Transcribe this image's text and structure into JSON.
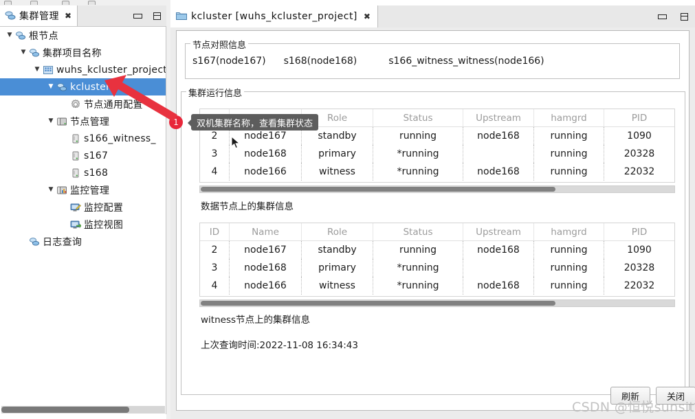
{
  "left_view": {
    "tab": {
      "title": "集群管理",
      "close": "✖",
      "icon": "cluster-icon"
    },
    "window_controls": {
      "minimize": "minimize-icon",
      "maximize": "maximize-icon"
    },
    "tree": [
      {
        "label": "根节点",
        "depth": 0,
        "twisty": "▼",
        "icon": "cluster-icon",
        "selected": false
      },
      {
        "label": "集群项目名称",
        "depth": 1,
        "twisty": "▼",
        "icon": "cluster-icon",
        "selected": false
      },
      {
        "label": "wuhs_kcluster_project",
        "depth": 2,
        "twisty": "▼",
        "icon": "project-icon",
        "selected": false
      },
      {
        "label": "kcluster",
        "depth": 3,
        "twisty": "▼",
        "icon": "cluster-icon",
        "selected": true
      },
      {
        "label": "节点通用配置",
        "depth": 4,
        "twisty": "",
        "icon": "gear-icon",
        "selected": false
      },
      {
        "label": "节点管理",
        "depth": 3,
        "twisty": "▼",
        "icon": "nodes-icon",
        "selected": false
      },
      {
        "label": "s166_witness_",
        "depth": 4,
        "twisty": "",
        "icon": "server-icon",
        "selected": false
      },
      {
        "label": "s167",
        "depth": 4,
        "twisty": "",
        "icon": "server-icon",
        "selected": false
      },
      {
        "label": "s168",
        "depth": 4,
        "twisty": "",
        "icon": "server-icon",
        "selected": false
      },
      {
        "label": "监控管理",
        "depth": 3,
        "twisty": "▼",
        "icon": "monitor-mgmt-icon",
        "selected": false
      },
      {
        "label": "监控配置",
        "depth": 4,
        "twisty": "",
        "icon": "monitor-config-icon",
        "selected": false
      },
      {
        "label": "监控视图",
        "depth": 4,
        "twisty": "",
        "icon": "monitor-view-icon",
        "selected": false
      },
      {
        "label": "日志查询",
        "depth": 1,
        "twisty": "",
        "icon": "log-icon",
        "selected": false
      }
    ]
  },
  "right_view": {
    "tab": {
      "title": "kcluster [wuhs_kcluster_project]",
      "close": "✖",
      "icon": "folder-icon"
    },
    "window_controls": {
      "minimize": "minimize-icon",
      "maximize": "maximize-icon"
    },
    "compare_group": {
      "legend": "节点对照信息",
      "entries": [
        "s167(node167)",
        "s168(node168)",
        "s166_witness_witness(node166)"
      ]
    },
    "run_group": {
      "legend": "集群运行信息",
      "table1_caption": "数据节点上的集群信息",
      "table2_caption": "witness节点上的集群信息",
      "last_query": "上次查询时间:2022-11-08  16:34:43"
    },
    "table": {
      "columns": [
        "ID",
        "Name",
        "Role",
        "Status",
        "Upstream",
        "hamgrd",
        "PID",
        ""
      ],
      "rows": [
        [
          "2",
          "node167",
          "standby",
          "running",
          "node168",
          "running",
          "1090",
          ""
        ],
        [
          "3",
          "node168",
          "primary",
          "*running",
          "",
          "running",
          "20328",
          ""
        ],
        [
          "4",
          "node166",
          "witness",
          "*running",
          "node168",
          "running",
          "22032",
          ""
        ]
      ]
    },
    "buttons": {
      "refresh": "刷新",
      "close": "关闭"
    }
  },
  "annotations": {
    "badge_1": "1",
    "tooltip": "双机集群名称，查看集群状态"
  },
  "watermark": "CSDN @恒悦sunsite",
  "colors": {
    "selection": "#4a8ed6",
    "badge": "#e8273a",
    "tooltip_bg": "#5d5d5d",
    "header_text": "#9b9b9b",
    "arrow": "#e8323f"
  }
}
